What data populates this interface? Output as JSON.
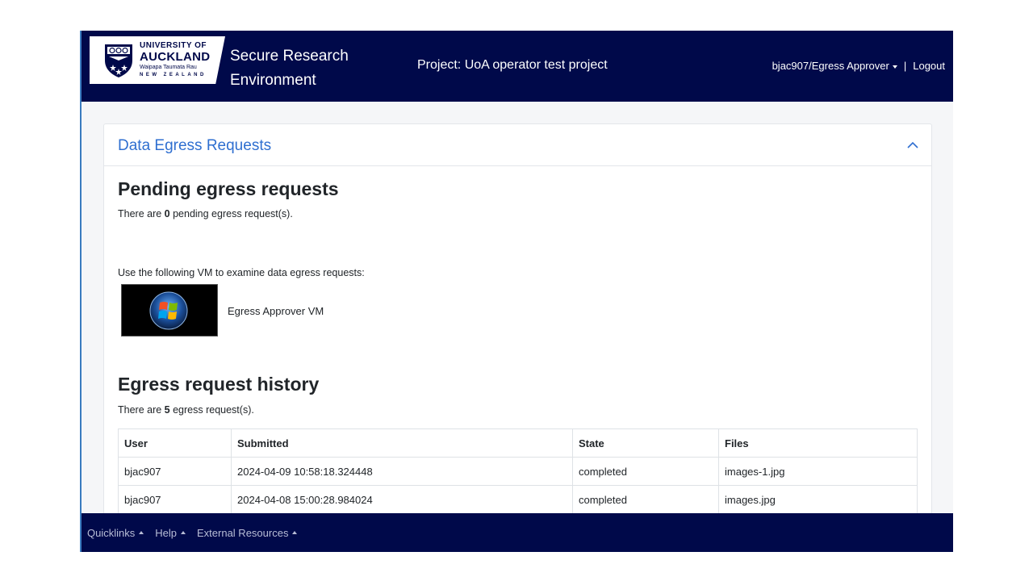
{
  "header": {
    "logo": {
      "line1": "UNIVERSITY OF",
      "line2": "AUCKLAND",
      "line3": "Waipapa Taumata Rau",
      "line4": "NEW ZEALAND"
    },
    "app_title": "Secure Research Environment",
    "project_label": "Project: UoA operator test project",
    "user_menu": "bjac907/Egress Approver",
    "separator": "|",
    "logout": "Logout"
  },
  "card": {
    "title": "Data Egress Requests",
    "collapse_icon": "chevron-up-icon",
    "pending": {
      "heading": "Pending egress requests",
      "text_before": "There are ",
      "count": "0",
      "text_after": " pending egress request(s)."
    },
    "vm": {
      "instruction": "Use the following VM to examine data egress requests:",
      "label": "Egress Approver VM",
      "icon": "windows-logo-icon"
    },
    "history": {
      "heading": "Egress request history",
      "text_before": "There are ",
      "count": "5",
      "text_after": " egress request(s).",
      "columns": [
        "User",
        "Submitted",
        "State",
        "Files"
      ],
      "rows": [
        [
          "bjac907",
          "2024-04-09 10:58:18.324448",
          "completed",
          "images-1.jpg"
        ],
        [
          "bjac907",
          "2024-04-08 15:00:28.984024",
          "completed",
          "images.jpg"
        ]
      ]
    }
  },
  "footer": {
    "items": [
      "Quicklinks",
      "Help",
      "External Resources"
    ]
  },
  "colors": {
    "navy": "#00094a",
    "link_blue": "#2f6fd0"
  }
}
